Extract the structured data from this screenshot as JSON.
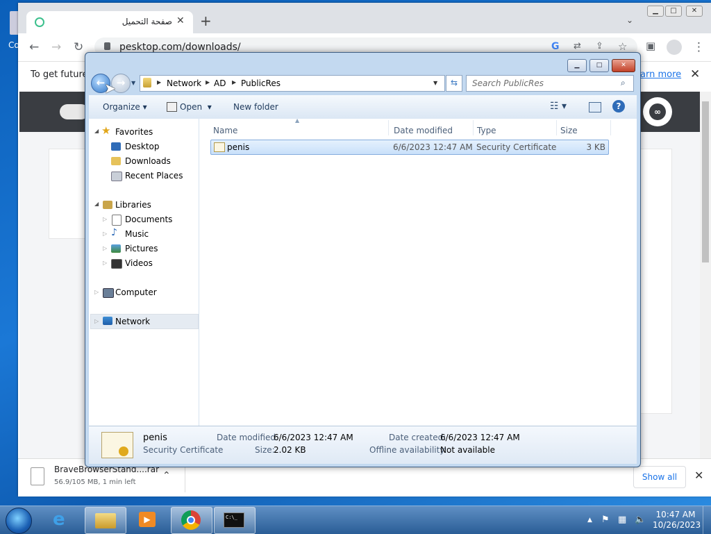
{
  "desktop": {
    "icon_label": "Co"
  },
  "browser": {
    "tab_title": "صفحة التحميل",
    "tab_close": "✕",
    "new_tab": "+",
    "url": "pesktop.com/downloads/",
    "infobar_text": "To get future",
    "infobar_link": "earn more",
    "infobar_close": "✕",
    "logo_text": "∞",
    "download": {
      "file_name": "BraveBrowserStand....rar",
      "progress": "56.9/105 MB, 1 min left",
      "show_all": "Show all",
      "close": "✕"
    }
  },
  "explorer": {
    "window_controls": {
      "minimize": "▁",
      "maximize": "□",
      "close": "✕"
    },
    "breadcrumb": [
      "Network",
      "AD",
      "PublicRes"
    ],
    "search_placeholder": "Search PublicRes",
    "commands": {
      "organize": "Organize",
      "open": "Open",
      "new_folder": "New folder"
    },
    "nav": {
      "favorites": "Favorites",
      "favorites_items": [
        "Desktop",
        "Downloads",
        "Recent Places"
      ],
      "libraries": "Libraries",
      "libraries_items": [
        "Documents",
        "Music",
        "Pictures",
        "Videos"
      ],
      "computer": "Computer",
      "network": "Network"
    },
    "columns": {
      "name": "Name",
      "date_modified": "Date modified",
      "type": "Type",
      "size": "Size"
    },
    "files": [
      {
        "name": "penis",
        "date_modified": "6/6/2023 12:47 AM",
        "type": "Security Certificate",
        "size": "3 KB"
      }
    ],
    "details": {
      "name": "penis",
      "type": "Security Certificate",
      "date_modified_label": "Date modified:",
      "date_modified": "6/6/2023 12:47 AM",
      "size_label": "Size:",
      "size": "2.02 KB",
      "date_created_label": "Date created:",
      "date_created": "6/6/2023 12:47 AM",
      "offline_label": "Offline availability:",
      "offline": "Not available"
    }
  },
  "taskbar": {
    "time": "10:47 AM",
    "date": "10/26/2023",
    "cmd_icon_text": "C:\\_"
  }
}
